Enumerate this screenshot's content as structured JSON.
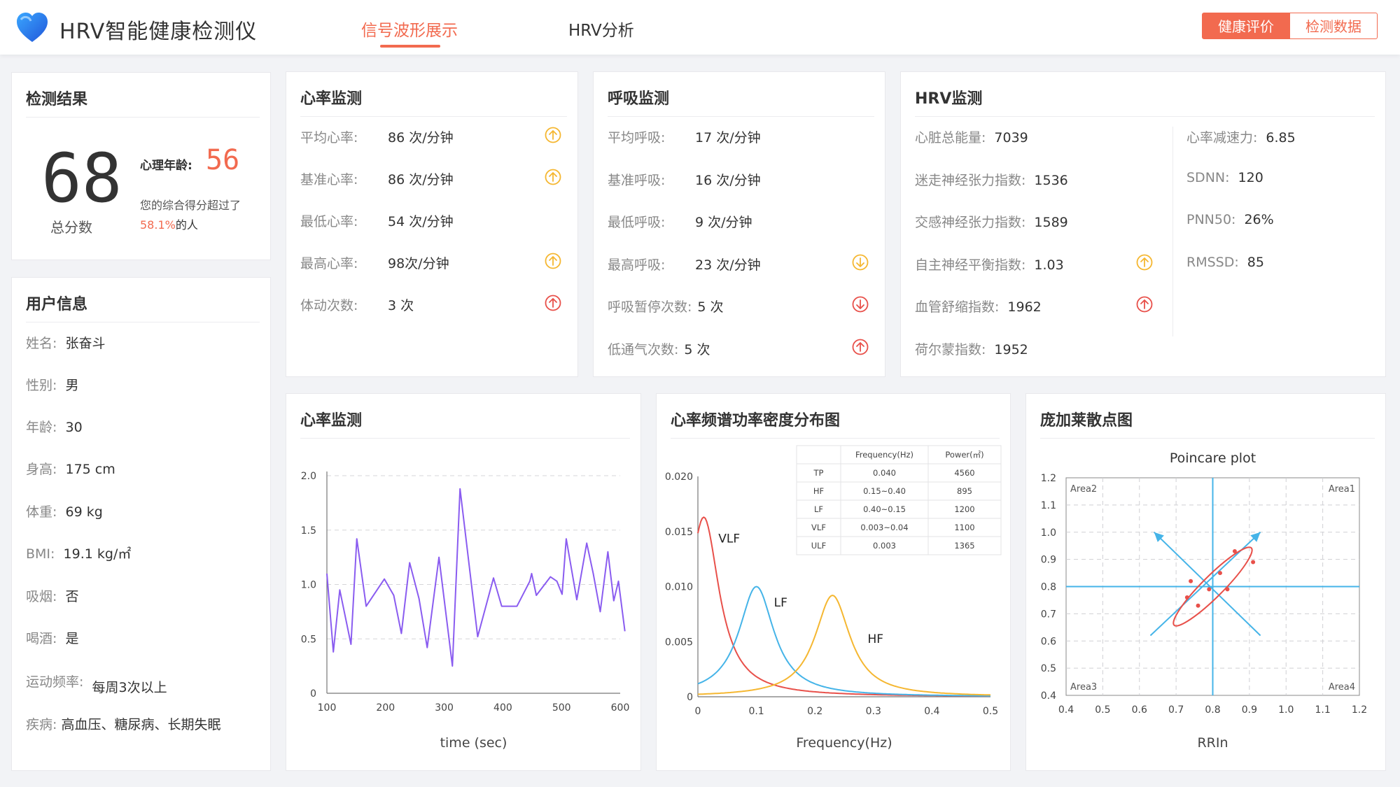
{
  "header": {
    "title": "HRV智能健康检测仪",
    "tabs": [
      {
        "label": "信号波形展示",
        "active": true
      },
      {
        "label": "HRV分析",
        "active": false
      }
    ],
    "buttons": {
      "health_eval": "健康评价",
      "detect_data": "检测数据"
    }
  },
  "result": {
    "title": "检测结果",
    "score": "68",
    "score_label": "总分数",
    "mental_age_label": "心理年龄:",
    "mental_age": "56",
    "desc": "您的综合得分超过了",
    "percent": "58.1%",
    "percent_suffix": "的人"
  },
  "user": {
    "title": "用户信息",
    "fields": [
      {
        "label": "姓名:",
        "value": "张奋斗"
      },
      {
        "label": "性别:",
        "value": "男"
      },
      {
        "label": "年龄:",
        "value": "30"
      },
      {
        "label": "身高:",
        "value": "175 cm"
      },
      {
        "label": "体重:",
        "value": "69 kg"
      },
      {
        "label": "BMI:",
        "value": "19.1 kg/㎡"
      },
      {
        "label": "吸烟:",
        "value": "否"
      },
      {
        "label": "喝酒:",
        "value": "是"
      },
      {
        "label": "运动频率:",
        "value": "每周3次以上"
      },
      {
        "label": "疾病:",
        "value": "高血压、糖尿病、长期失眠"
      }
    ]
  },
  "heart_rate": {
    "title": "心率监测",
    "rows": [
      {
        "label": "平均心率:",
        "value": "86 次/分钟",
        "icon": "arrow-up-circle-yellow"
      },
      {
        "label": "基准心率:",
        "value": "86 次/分钟",
        "icon": "arrow-up-circle-yellow"
      },
      {
        "label": "最低心率:",
        "value": "54 次/分钟",
        "icon": ""
      },
      {
        "label": "最高心率:",
        "value": "98次/分钟",
        "icon": "arrow-up-circle-yellow"
      },
      {
        "label": "体动次数:",
        "value": "3 次",
        "icon": "arrow-up-circle-red"
      }
    ]
  },
  "breath": {
    "title": "呼吸监测",
    "rows": [
      {
        "label": "平均呼吸:",
        "value": "17 次/分钟",
        "icon": ""
      },
      {
        "label": "基准呼吸:",
        "value": "16 次/分钟",
        "icon": ""
      },
      {
        "label": "最低呼吸:",
        "value": "9 次/分钟",
        "icon": ""
      },
      {
        "label": "最高呼吸:",
        "value": "23 次/分钟",
        "icon": "arrow-down-circle-yellow"
      },
      {
        "label": "呼吸暂停次数:",
        "value": "5 次",
        "icon": "arrow-down-circle-red"
      },
      {
        "label": "低通气次数:",
        "value": "5 次",
        "icon": "arrow-up-circle-red"
      }
    ]
  },
  "hrv": {
    "title": "HRV监测",
    "left_rows": [
      {
        "label": "心脏总能量:",
        "value": "7039",
        "icon": ""
      },
      {
        "label": "迷走神经张力指数:",
        "value": "1536",
        "icon": ""
      },
      {
        "label": "交感神经张力指数:",
        "value": "1589",
        "icon": ""
      },
      {
        "label": "自主神经平衡指数:",
        "value": "1.03",
        "icon": "arrow-up-circle-yellow"
      },
      {
        "label": "血管舒缩指数:",
        "value": "1962",
        "icon": "arrow-up-circle-red"
      },
      {
        "label": "荷尔蒙指数:",
        "value": "1952",
        "icon": ""
      }
    ],
    "right_rows": [
      {
        "label": "心率减速力:",
        "value": "6.85"
      },
      {
        "label": "SDNN:",
        "value": "120"
      },
      {
        "label": "PNN50:",
        "value": "26%"
      },
      {
        "label": "RMSSD:",
        "value": "85"
      }
    ]
  },
  "colors": {
    "accent": "#f26a4f",
    "yellow": "#f5b731",
    "red": "#e8504a",
    "purple": "#8a5cf0",
    "blue": "#45b4e8"
  },
  "charts": {
    "hr_title": "心率监测",
    "psd_title": "心率频谱功率密度分布图",
    "poincare_title": "庞加莱散点图"
  },
  "chart_data": [
    {
      "type": "line",
      "xlabel": "time (sec)",
      "ylabel": "",
      "xlim": [
        100,
        600
      ],
      "ylim": [
        0,
        2.0
      ],
      "x_ticks": [
        "100",
        "200",
        "300",
        "400",
        "500",
        "600"
      ],
      "y_ticks": [
        "0",
        "0.5",
        "1.0",
        "1.5",
        "2.0"
      ],
      "grid": "dashed-horizontal",
      "x": [
        100,
        111,
        122,
        141,
        151,
        167,
        198,
        214,
        227,
        241,
        257,
        271,
        291,
        314,
        327,
        357,
        384,
        398,
        415,
        424,
        446,
        449,
        457,
        481,
        492,
        501,
        508,
        526,
        543,
        554,
        566,
        579,
        589,
        597,
        608
      ],
      "y": [
        1.1,
        0.38,
        0.95,
        0.45,
        1.42,
        0.8,
        1.05,
        0.9,
        0.55,
        1.2,
        0.87,
        0.42,
        1.25,
        0.25,
        1.88,
        0.52,
        1.06,
        0.8,
        0.8,
        0.8,
        1.03,
        1.1,
        0.9,
        1.07,
        1.03,
        0.91,
        1.42,
        0.86,
        1.38,
        1.1,
        0.75,
        1.3,
        0.85,
        1.03,
        0.57
      ]
    },
    {
      "type": "line",
      "xlabel": "Frequency(Hz)",
      "ylabel": "",
      "xlim": [
        0,
        0.5
      ],
      "ylim": [
        0,
        0.02
      ],
      "x_ticks": [
        "0",
        "0.1",
        "0.2",
        "0.3",
        "0.4",
        "0.5"
      ],
      "y_ticks": [
        "0",
        "0.005",
        "0.010",
        "0.015",
        "0.020"
      ],
      "series": [
        {
          "name": "VLF",
          "color": "#e8504a",
          "peak_x": 0.01,
          "peak_y": 0.0163,
          "width": 0.035
        },
        {
          "name": "LF",
          "color": "#45b4e8",
          "peak_x": 0.1,
          "peak_y": 0.01,
          "width": 0.04
        },
        {
          "name": "HF",
          "color": "#f5b731",
          "peak_x": 0.23,
          "peak_y": 0.0092,
          "width": 0.04
        }
      ],
      "table": {
        "headers": [
          "",
          "Frequency(Hz)",
          "Power(㎡)"
        ],
        "rows": [
          [
            "TP",
            "0.040",
            "4560"
          ],
          [
            "HF",
            "0.15~0.40",
            "895"
          ],
          [
            "LF",
            "0.40~0.15",
            "1200"
          ],
          [
            "VLF",
            "0.003~0.04",
            "1100"
          ],
          [
            "ULF",
            "0.003",
            "1365"
          ]
        ]
      }
    },
    {
      "type": "scatter",
      "title": "Poincare plot",
      "xlabel": "RRIn",
      "ylabel": "",
      "xlim": [
        0.4,
        1.2
      ],
      "ylim": [
        0.4,
        1.2
      ],
      "x_ticks": [
        "0.4",
        "0.5",
        "0.6",
        "0.7",
        "0.8",
        "0.9",
        "1.0",
        "1.1",
        "1.2"
      ],
      "y_ticks": [
        "0.4",
        "0.5",
        "0.6",
        "0.7",
        "0.8",
        "0.9",
        "1.0",
        "1.1",
        "1.2"
      ],
      "quadrants": [
        "Area1",
        "Area2",
        "Area3",
        "Area4"
      ],
      "center": [
        0.8,
        0.8
      ],
      "points": [
        [
          0.86,
          0.93
        ],
        [
          0.91,
          0.89
        ],
        [
          0.74,
          0.82
        ],
        [
          0.79,
          0.79
        ],
        [
          0.84,
          0.79
        ],
        [
          0.76,
          0.73
        ],
        [
          0.73,
          0.76
        ],
        [
          0.82,
          0.85
        ]
      ]
    }
  ]
}
